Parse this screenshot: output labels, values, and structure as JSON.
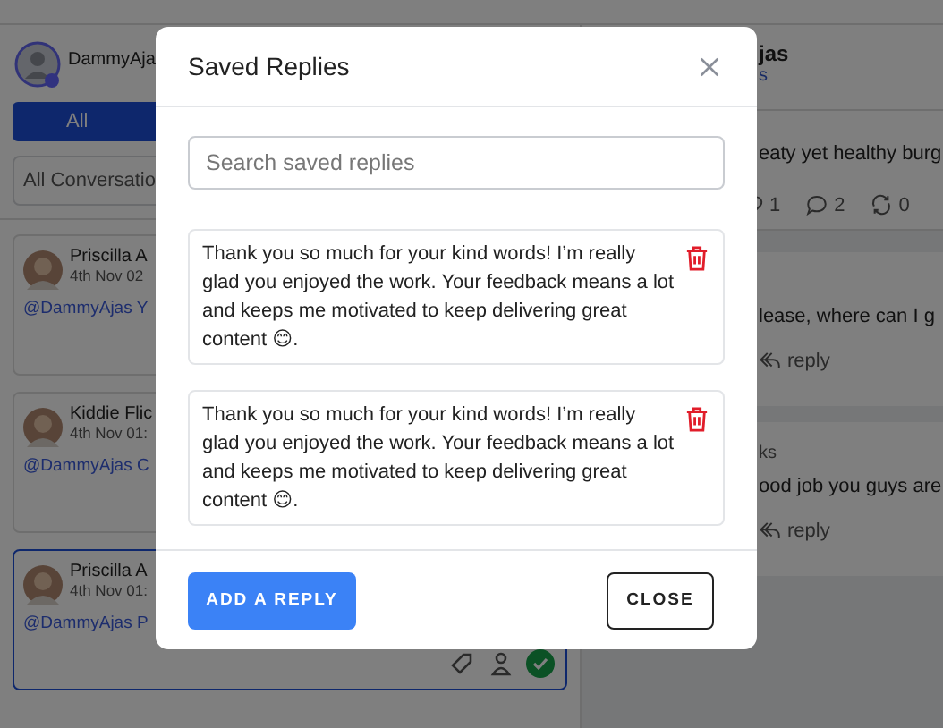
{
  "background": {
    "account": {
      "name": "DammyAja"
    },
    "filter_tabs": [
      {
        "label": "All",
        "selected": true
      }
    ],
    "conversation_filter": {
      "value": "All Conversatio"
    },
    "conversations": [
      {
        "name": "Priscilla A",
        "time": "4th Nov 02",
        "preview": "@DammyAjas Y",
        "selected": false
      },
      {
        "name": "Kiddie Flic",
        "time": "4th Nov 01:",
        "preview": "@DammyAjas C",
        "selected": false
      },
      {
        "name": "Priscilla A",
        "time": "4th Nov 01:",
        "preview": "@DammyAjas P",
        "selected": true
      }
    ],
    "post": {
      "author": "jas",
      "handle": "s",
      "text": "eaty yet healthy burg",
      "stats": [
        {
          "kind": "like",
          "count": "1"
        },
        {
          "kind": "comment",
          "count": "2"
        },
        {
          "kind": "repost",
          "count": "0"
        }
      ]
    },
    "comments": [
      {
        "text": "lease, where can I g",
        "action": "reply"
      },
      {
        "author": "ks",
        "text": "ood job you guys are",
        "action": "reply"
      }
    ]
  },
  "modal": {
    "title": "Saved Replies",
    "search": {
      "placeholder": "Search saved replies"
    },
    "replies": [
      {
        "text": "Thank you so much for your kind words! I’m really glad you enjoyed the work. Your feedback means a lot and keeps me motivated to keep delivering great content 😊."
      },
      {
        "text": "Thank you so much for your kind words! I’m really glad you enjoyed the work. Your feedback means a lot and keeps me motivated to keep delivering great content 😊."
      }
    ],
    "buttons": [
      {
        "label": "ADD A REPLY",
        "kind": "primary"
      },
      {
        "label": "CLOSE",
        "kind": "secondary"
      }
    ]
  }
}
